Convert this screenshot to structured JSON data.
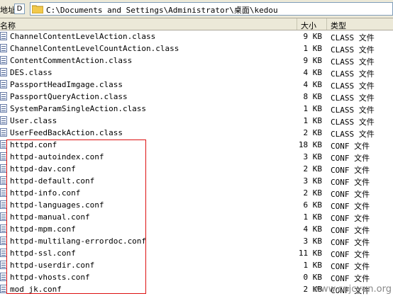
{
  "address": {
    "label": "地址",
    "accel": "D",
    "path": "C:\\Documents and Settings\\Administrator\\桌面\\kedou"
  },
  "columns": {
    "name": "名称",
    "size": "大小",
    "type": "类型"
  },
  "files": [
    {
      "name": "ChannelContentLevelAction.class",
      "size": "9 KB",
      "type": "CLASS 文件"
    },
    {
      "name": "ChannelContentLevelCountAction.class",
      "size": "1 KB",
      "type": "CLASS 文件"
    },
    {
      "name": "ContentCommentAction.class",
      "size": "9 KB",
      "type": "CLASS 文件"
    },
    {
      "name": "DES.class",
      "size": "4 KB",
      "type": "CLASS 文件"
    },
    {
      "name": "PassportHeadImgage.class",
      "size": "4 KB",
      "type": "CLASS 文件"
    },
    {
      "name": "PassportQueryAction.class",
      "size": "8 KB",
      "type": "CLASS 文件"
    },
    {
      "name": "SystemParamSingleAction.class",
      "size": "1 KB",
      "type": "CLASS 文件"
    },
    {
      "name": "User.class",
      "size": "1 KB",
      "type": "CLASS 文件"
    },
    {
      "name": "UserFeedBackAction.class",
      "size": "2 KB",
      "type": "CLASS 文件"
    },
    {
      "name": "httpd.conf",
      "size": "18 KB",
      "type": "CONF 文件"
    },
    {
      "name": "httpd-autoindex.conf",
      "size": "3 KB",
      "type": "CONF 文件"
    },
    {
      "name": "httpd-dav.conf",
      "size": "2 KB",
      "type": "CONF 文件"
    },
    {
      "name": "httpd-default.conf",
      "size": "3 KB",
      "type": "CONF 文件"
    },
    {
      "name": "httpd-info.conf",
      "size": "2 KB",
      "type": "CONF 文件"
    },
    {
      "name": "httpd-languages.conf",
      "size": "6 KB",
      "type": "CONF 文件"
    },
    {
      "name": "httpd-manual.conf",
      "size": "1 KB",
      "type": "CONF 文件"
    },
    {
      "name": "httpd-mpm.conf",
      "size": "4 KB",
      "type": "CONF 文件"
    },
    {
      "name": "httpd-multilang-errordoc.conf",
      "size": "3 KB",
      "type": "CONF 文件"
    },
    {
      "name": "httpd-ssl.conf",
      "size": "11 KB",
      "type": "CONF 文件"
    },
    {
      "name": "httpd-userdir.conf",
      "size": "1 KB",
      "type": "CONF 文件"
    },
    {
      "name": "httpd-vhosts.conf",
      "size": "0 KB",
      "type": "CONF 文件"
    },
    {
      "name": "mod_jk.conf",
      "size": "2 KB",
      "type": "CONF 文件"
    }
  ],
  "watermark": "www.cnjcyun.org",
  "colors": {
    "toolbar_bg": "#ece9d8",
    "highlight_box": "#dd1111"
  }
}
